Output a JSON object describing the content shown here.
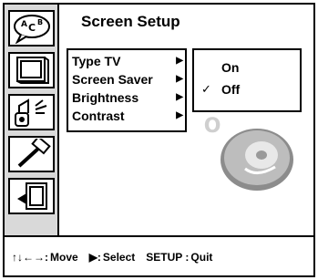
{
  "title": "Screen Setup",
  "menu": {
    "items": [
      {
        "label": "Type TV"
      },
      {
        "label": "Screen Saver"
      },
      {
        "label": "Brightness"
      },
      {
        "label": "Contrast"
      }
    ],
    "arrow": "▶"
  },
  "options": {
    "items": [
      {
        "label": "On",
        "checked": false
      },
      {
        "label": "Off",
        "checked": true
      }
    ],
    "check_mark": "✓"
  },
  "sidebar": {
    "icons": [
      "language-icon",
      "screen-icon",
      "sound-icon",
      "tools-icon",
      "exit-icon"
    ],
    "language_icon_text": "A C B"
  },
  "footer": {
    "move_keys": "↑↓←→:",
    "move_label": "Move",
    "select_key": "▶:",
    "select_label": "Select",
    "setup_key": "SETUP :",
    "quit_label": "Quit"
  },
  "colors": {
    "sidebar_bg": "#d9d9d9",
    "frame": "#000000",
    "watermark": "#b5b5b5"
  }
}
